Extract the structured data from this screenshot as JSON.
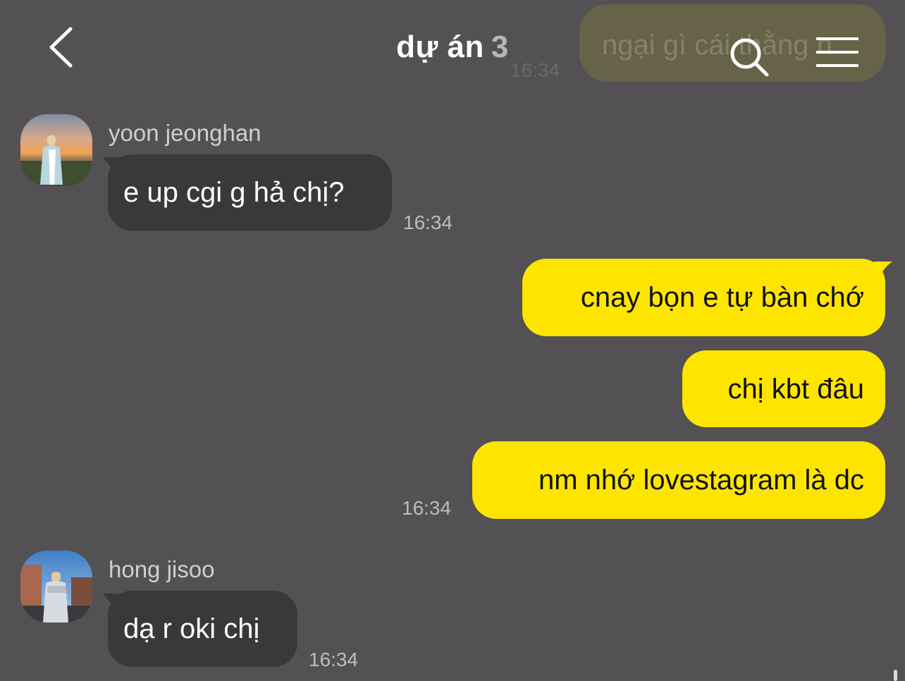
{
  "header": {
    "title": "dự án",
    "member_count": "3",
    "back_icon": "chevron-left-icon",
    "search_icon": "search-icon",
    "menu_icon": "hamburger-menu-icon"
  },
  "ghost": {
    "text": "ngại gì cái thằng n",
    "time": "16:34"
  },
  "messages": [
    {
      "sender": "yoon jeonghan",
      "text": "e up cgi g hả chị?",
      "time": "16:34"
    },
    {
      "text": "cnay bọn e tự bàn chớ"
    },
    {
      "text": "chị kbt đâu"
    },
    {
      "text": "nm nhớ lovestagram là dc",
      "time": "16:34"
    },
    {
      "sender": "hong jisoo",
      "text": "dạ r oki chị",
      "time": "16:34"
    }
  ],
  "colors": {
    "background": "#535153",
    "incoming_bubble": "#3a383a",
    "outgoing_bubble": "#fee500"
  }
}
